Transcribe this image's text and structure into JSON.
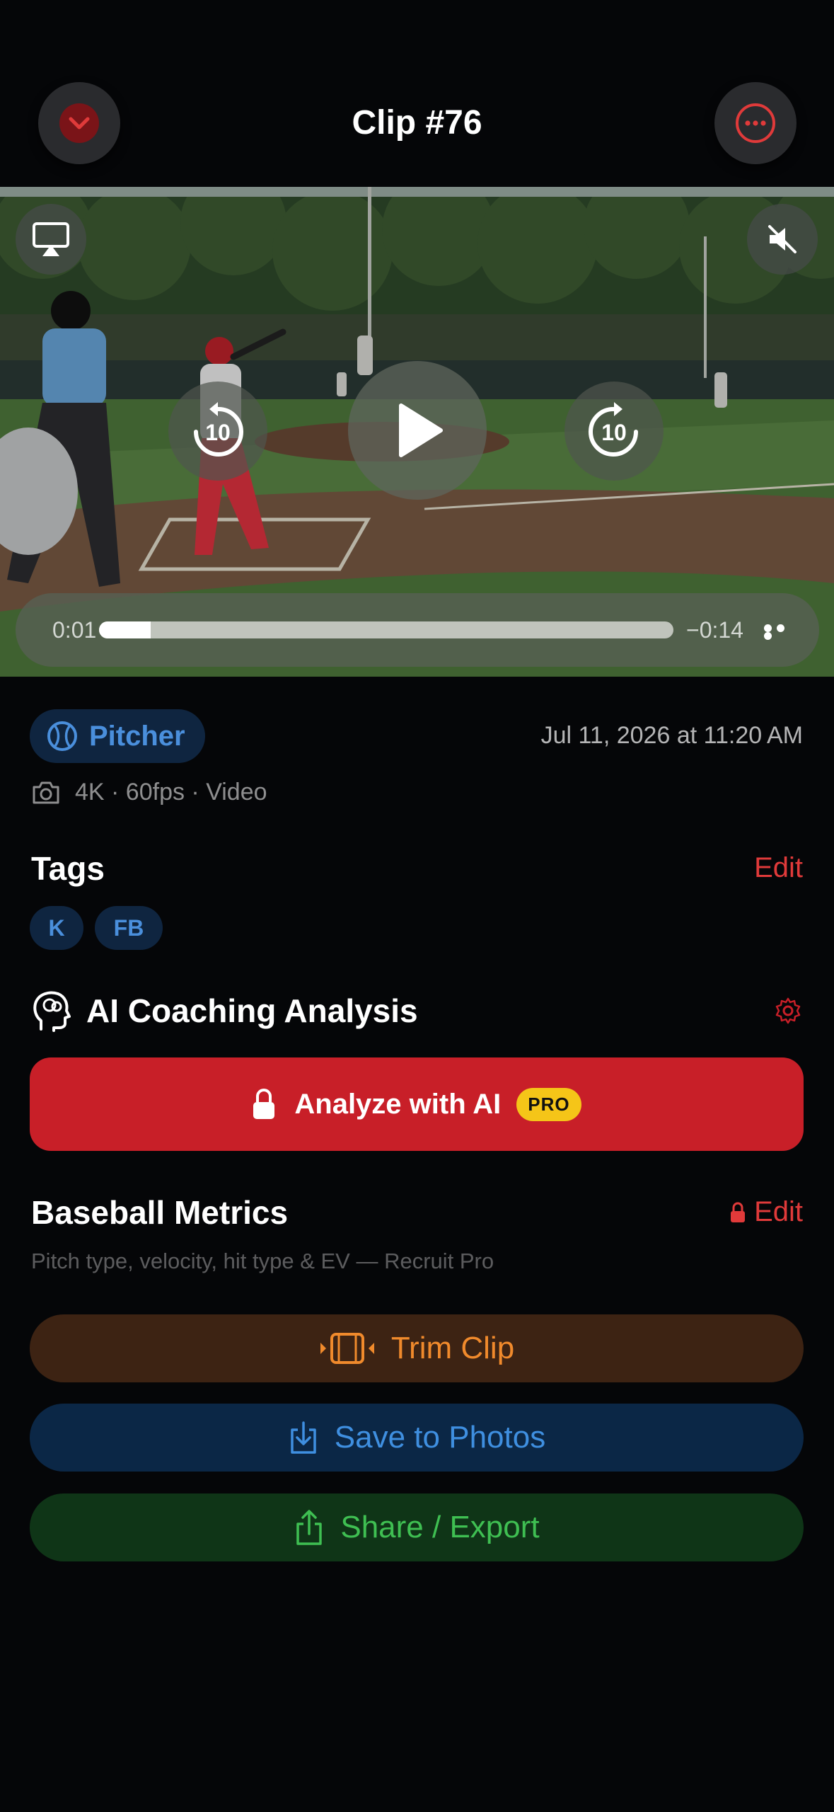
{
  "header": {
    "title": "Clip #76"
  },
  "player": {
    "current_time": "0:01",
    "remaining_time": "−0:14",
    "progress": 0.09,
    "skip_back_seconds": "10",
    "skip_forward_seconds": "10"
  },
  "clip": {
    "position_label": "Pitcher",
    "date": "Jul 11, 2026 at 11:20 AM",
    "format": "4K · 60fps · Video"
  },
  "tags": {
    "title": "Tags",
    "edit_label": "Edit",
    "items": [
      "K",
      "FB"
    ]
  },
  "ai": {
    "title": "AI Coaching Analysis",
    "analyze_label": "Analyze with AI",
    "badge": "PRO"
  },
  "metrics": {
    "title": "Baseball Metrics",
    "edit_label": "Edit",
    "subtitle": "Pitch type, velocity, hit type & EV — Recruit Pro"
  },
  "actions": {
    "trim_label": "Trim Clip",
    "save_label": "Save to Photos",
    "share_label": "Share / Export"
  },
  "colors": {
    "accent_red": "#c81f28",
    "pill_blue": "#4a8fdc",
    "trim_orange": "#f08a2c",
    "save_blue": "#3f8fe0",
    "share_green": "#3fbf52"
  }
}
